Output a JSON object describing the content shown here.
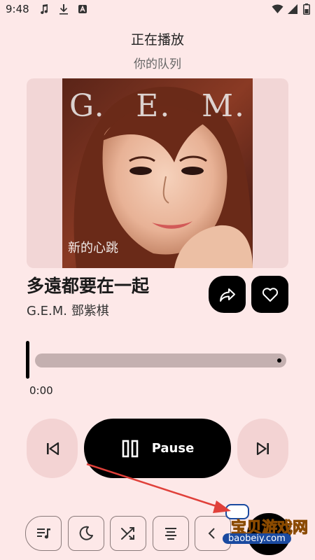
{
  "status_bar": {
    "time": "9:48",
    "left_icons": [
      "music-note-icon",
      "download-icon",
      "app-a-icon"
    ],
    "right_icons": [
      "wifi-icon",
      "signal-icon",
      "battery-icon"
    ]
  },
  "header": {
    "title": "正在播放",
    "subtitle": "你的队列"
  },
  "album_art": {
    "letters": [
      "G.",
      "E.",
      "M."
    ],
    "caption": "新的心跳"
  },
  "track": {
    "title": "多遠都要在一起",
    "artist": "G.E.M. 鄧紫棋"
  },
  "actions": {
    "share_icon": "share-icon",
    "favorite_icon": "heart-icon"
  },
  "progress": {
    "elapsed": "0:00",
    "fraction": 0.0
  },
  "transport": {
    "prev_icon": "skip-previous-icon",
    "pause_icon": "pause-icon",
    "pause_label": "Pause",
    "next_icon": "skip-next-icon"
  },
  "bottom_bar": {
    "items": [
      "queue-music-icon",
      "sleep-timer-icon",
      "shuffle-icon",
      "lyrics-icon",
      "more-icon"
    ]
  },
  "watermark": {
    "text": "宝贝游戏网",
    "url": "baobeiy.com"
  },
  "colors": {
    "background": "#fde8e8",
    "accent": "#000000",
    "button_tint": "#f3d3d3",
    "track_fill": "#c4b0b0",
    "annotation": "#e0403a"
  }
}
